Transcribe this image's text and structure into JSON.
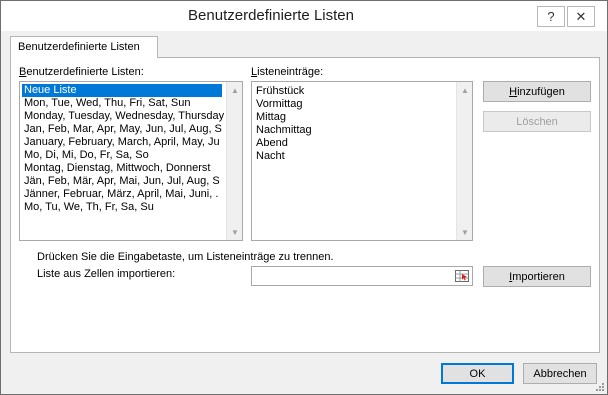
{
  "window": {
    "title": "Benutzerdefinierte Listen",
    "help_glyph": "?",
    "close_glyph": "✕"
  },
  "tab": {
    "label": "Benutzerdefinierte Listen"
  },
  "lists": {
    "label_accel": "B",
    "label_rest": "enutzerdefinierte Listen:",
    "items": [
      "Neue Liste",
      "Mon, Tue, Wed, Thu, Fri, Sat, Sun",
      "Monday, Tuesday, Wednesday, Thursday",
      "Jan, Feb, Mar, Apr, May, Jun, Jul, Aug, S",
      "January, February, March, April, May, Ju",
      "Mo, Di, Mi, Do, Fr, Sa, So",
      "Montag, Dienstag, Mittwoch, Donnerst",
      "Jän, Feb, Mär, Apr, Mai, Jun, Jul, Aug, S",
      "Jänner, Februar, März, April, Mai, Juni, .",
      "Mo, Tu, We, Th, Fr, Sa, Su"
    ],
    "selected_index": 0
  },
  "entries": {
    "label_accel": "L",
    "label_rest": "isteneinträge:",
    "items": [
      "Frühstück",
      "Vormittag",
      "Mittag",
      "Nachmittag",
      "Abend",
      "Nacht"
    ]
  },
  "buttons": {
    "add_accel": "H",
    "add_rest": "inzufügen",
    "delete": "Löschen",
    "import_accel": "I",
    "import_rest": "mportieren",
    "ok": "OK",
    "cancel": "Abbrechen"
  },
  "hint": "Drücken Sie die Eingabetaste, um Listeneinträge zu trennen.",
  "import": {
    "label": "Liste aus Zellen importieren:",
    "value": ""
  },
  "icons": {
    "scroll_up": "scroll-up-arrow-icon",
    "scroll_down": "scroll-down-arrow-icon",
    "range_selector": "range-select-icon",
    "resize_grip": "resize-grip-icon"
  },
  "colors": {
    "selection": "#0078d7",
    "dialog_bg": "#f0f0f0",
    "panel_bg": "#ffffff"
  }
}
